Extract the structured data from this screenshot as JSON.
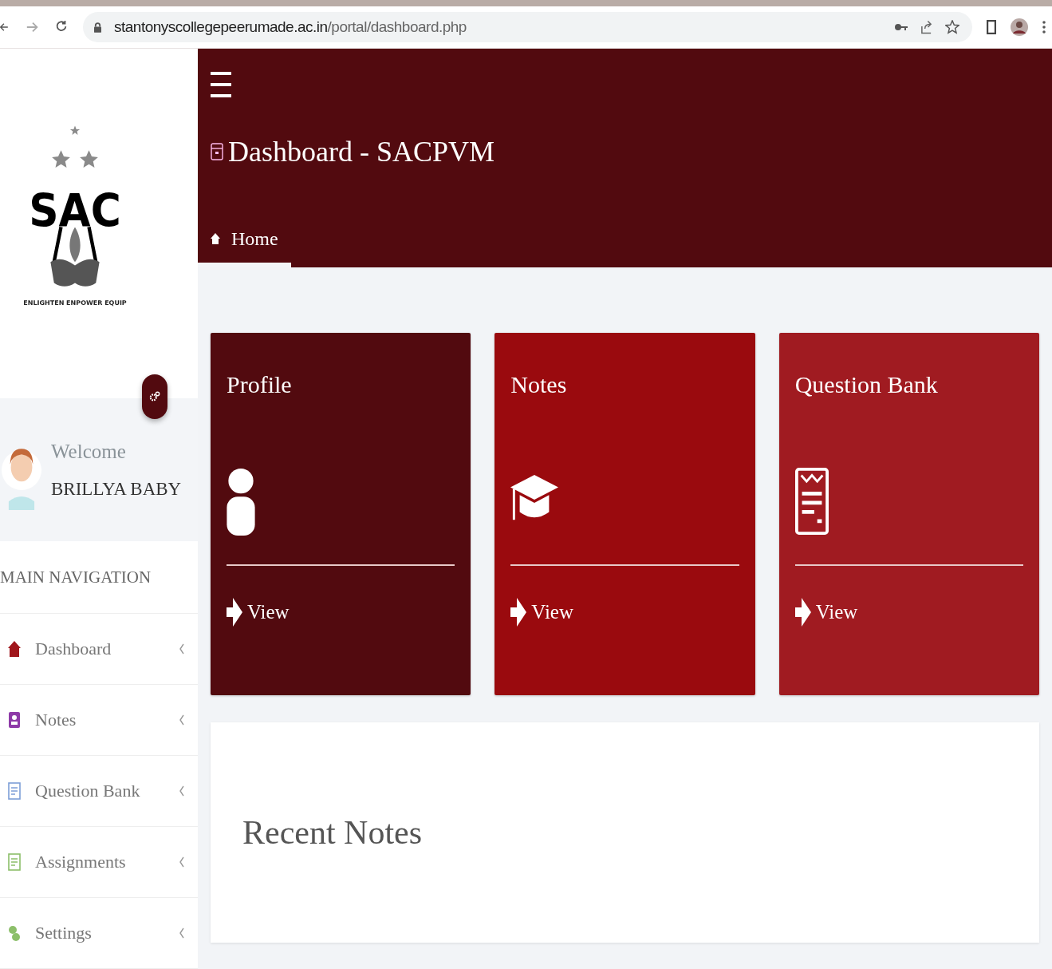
{
  "browser": {
    "url_host": "stantonyscollegepeerumade.ac.in",
    "url_path": "/portal/dashboard.php"
  },
  "logo": {
    "letters": "SAC",
    "motto": "ENLIGHTEN ENPOWER EQUIP"
  },
  "user": {
    "greeting": "Welcome",
    "name": "BRILLYA BABY"
  },
  "sidebar": {
    "heading": "MAIN NAVIGATION",
    "items": [
      {
        "label": "Dashboard",
        "kind": "home"
      },
      {
        "label": "Notes",
        "kind": "notes"
      },
      {
        "label": "Question Bank",
        "kind": "questions"
      },
      {
        "label": "Assignments",
        "kind": "assignments"
      },
      {
        "label": "Settings",
        "kind": "settings"
      }
    ]
  },
  "header": {
    "title": "Dashboard - SACPVM",
    "breadcrumb": [
      {
        "label": "Home",
        "selected": true
      }
    ]
  },
  "cards": [
    {
      "title": "Profile",
      "kind": "user",
      "link": "View",
      "color": "#520a0f"
    },
    {
      "title": "Notes",
      "kind": "cap",
      "link": "View",
      "color": "#9a0a0e"
    },
    {
      "title": "Question Bank",
      "kind": "list",
      "link": "View",
      "color": "#a01b21"
    }
  ],
  "panel": {
    "title": "Recent Notes"
  }
}
